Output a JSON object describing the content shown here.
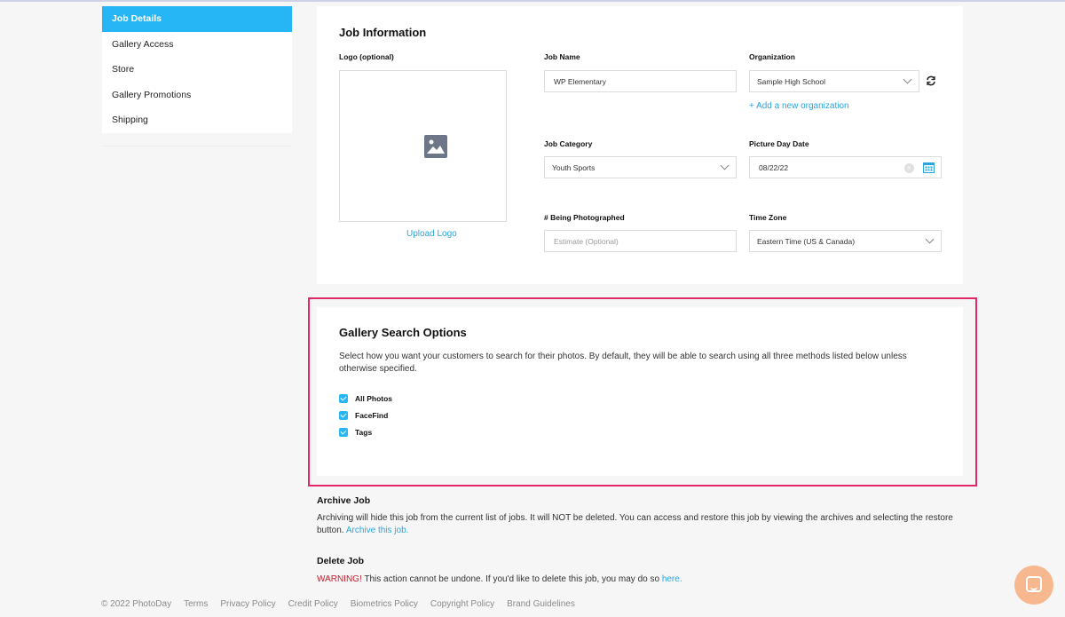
{
  "sidebar": {
    "items": [
      {
        "label": "Job Details",
        "active": true
      },
      {
        "label": "Gallery Access"
      },
      {
        "label": "Store"
      },
      {
        "label": "Gallery Promotions"
      },
      {
        "label": "Shipping"
      }
    ]
  },
  "job_info": {
    "title": "Job Information",
    "logo_label": "Logo (optional)",
    "upload_logo": "Upload Logo",
    "job_name_label": "Job Name",
    "job_name_value": "WP Elementary",
    "organization_label": "Organization",
    "organization_value": "Sample High School",
    "add_org": "+ Add a new organization",
    "job_category_label": "Job Category",
    "job_category_value": "Youth Sports",
    "picture_day_label": "Picture Day Date",
    "picture_day_value": "08/22/22",
    "being_photographed_label": "# Being Photographed",
    "being_photographed_placeholder": "Estimate (Optional)",
    "time_zone_label": "Time Zone",
    "time_zone_value": "Eastern Time (US & Canada)"
  },
  "gallery_search": {
    "title": "Gallery Search Options",
    "description": "Select how you want your customers to search for their photos. By default, they will be able to search using all three methods listed below unless otherwise specified.",
    "options": [
      {
        "label": "All Photos",
        "checked": true
      },
      {
        "label": "FaceFind",
        "checked": true
      },
      {
        "label": "Tags",
        "checked": true
      }
    ]
  },
  "archive": {
    "title": "Archive Job",
    "text": "Archiving will hide this job from the current list of jobs. It will NOT be deleted. You can access and restore this job by viewing the archives and selecting the restore button.",
    "link": "Archive this job."
  },
  "delete": {
    "title": "Delete Job",
    "warning": "WARNING!",
    "text": "This action cannot be undone. If you'd like to delete this job, you may do so",
    "link": "here."
  },
  "footer": {
    "copyright": "© 2022 PhotoDay",
    "links": [
      "Terms",
      "Privacy Policy",
      "Credit Policy",
      "Biometrics Policy",
      "Copyright Policy",
      "Brand Guidelines"
    ]
  },
  "colors": {
    "accent": "#27b6f5",
    "link": "#2aa6dd",
    "highlight": "#e0286a",
    "warning": "#c21f2d",
    "chat": "#f7b88f"
  }
}
